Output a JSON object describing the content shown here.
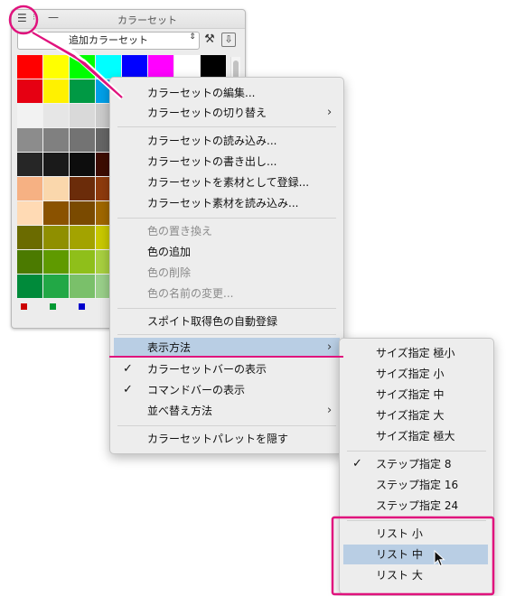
{
  "palette": {
    "title": "カラーセット",
    "menu_glyph": "☰",
    "title_dots": "⁝",
    "minimize_glyph": "—",
    "set_name": "追加カラーセット",
    "select_arrows": "⇕",
    "settings_glyph": "⚒",
    "download_glyph": "⇩",
    "swatches": [
      [
        "#ff0000",
        "#ffff00",
        "#00ff00",
        "#00ffff",
        "#0000ff",
        "#ff00ff",
        "#ffffff",
        "#000000"
      ],
      [
        "#e60012",
        "#fff100",
        "#009944",
        "#00a0e9",
        "#1d2088",
        "#e4007f",
        "#f0f0f0",
        "#1a1a1a"
      ],
      [
        "#f2f2f2",
        "#e6e6e6",
        "#d9d9d9",
        "#cccccc",
        "#bfbfbf",
        "#b3b3b3",
        "#a6a6a6",
        "#999999"
      ],
      [
        "#8c8c8c",
        "#808080",
        "#737373",
        "#666666",
        "#595959",
        "#4d4d4d",
        "#404040",
        "#333333"
      ],
      [
        "#262626",
        "#1a1a1a",
        "#0d0d0d",
        "#3d0c02",
        "#5c1a0b",
        "#7b2a12",
        "#9a3a1a",
        "#b94a22"
      ],
      [
        "#f6b183",
        "#fad7ac",
        "#6b2c0a",
        "#8f3b0d",
        "#b34c10",
        "#c46a1a",
        "#d68a2a",
        "#e8aa3a"
      ],
      [
        "#ffdab4",
        "#8a5200",
        "#7a4a00",
        "#a06800",
        "#c08200",
        "#d9a000",
        "#e6b800",
        "#f2d000"
      ],
      [
        "#6b6b00",
        "#8f8f00",
        "#a3a300",
        "#c9c900",
        "#d9d900",
        "#e6e600",
        "#f0f000",
        "#ffff66"
      ],
      [
        "#4b7a00",
        "#5f9a00",
        "#8fbf1a",
        "#a8d040",
        "#b8dc5a",
        "#c8e674",
        "#d8f08e",
        "#e8f8a8"
      ],
      [
        "#008a3a",
        "#22a846",
        "#7ac06a",
        "#9ad08a",
        "#b4e0a4",
        "#c8ecbe",
        "#dcf4d4",
        "#eefaea"
      ]
    ],
    "cmd_colors": [
      "#cc0000",
      "#009933",
      "#0000cc"
    ]
  },
  "menu": {
    "items": [
      {
        "label": "カラーセットの編集...",
        "enabled": true
      },
      {
        "label": "カラーセットの切り替え",
        "enabled": true,
        "submenu_glyph": "›"
      },
      {
        "label": "カラーセットの読み込み...",
        "enabled": true
      },
      {
        "label": "カラーセットの書き出し...",
        "enabled": true
      },
      {
        "label": "カラーセットを素材として登録...",
        "enabled": true
      },
      {
        "label": "カラーセット素材を読み込み...",
        "enabled": true
      },
      {
        "label": "色の置き換え",
        "enabled": false
      },
      {
        "label": "色の追加",
        "enabled": true
      },
      {
        "label": "色の削除",
        "enabled": false
      },
      {
        "label": "色の名前の変更...",
        "enabled": false
      },
      {
        "label": "スポイト取得色の自動登録",
        "enabled": true
      },
      {
        "label": "表示方法",
        "enabled": true,
        "highlighted": true,
        "submenu_glyph": "›"
      },
      {
        "label": "カラーセットバーの表示",
        "enabled": true,
        "checked": true,
        "check_glyph": "✓"
      },
      {
        "label": "コマンドバーの表示",
        "enabled": true,
        "checked": true,
        "check_glyph": "✓"
      },
      {
        "label": "並べ替え方法",
        "enabled": true,
        "submenu_glyph": "›"
      },
      {
        "label": "カラーセットパレットを隠す",
        "enabled": true
      }
    ]
  },
  "submenu": {
    "items": [
      {
        "label": "サイズ指定 極小"
      },
      {
        "label": "サイズ指定 小"
      },
      {
        "label": "サイズ指定 中"
      },
      {
        "label": "サイズ指定 大"
      },
      {
        "label": "サイズ指定 極大"
      },
      {
        "label": "ステップ指定 8",
        "checked": true,
        "check_glyph": "✓"
      },
      {
        "label": "ステップ指定 16"
      },
      {
        "label": "ステップ指定 24"
      },
      {
        "label": "リスト 小"
      },
      {
        "label": "リスト 中",
        "highlighted": true
      },
      {
        "label": "リスト 大"
      }
    ]
  },
  "colors": {
    "annotation": "#e0137d",
    "highlight": "#b9cee4"
  }
}
